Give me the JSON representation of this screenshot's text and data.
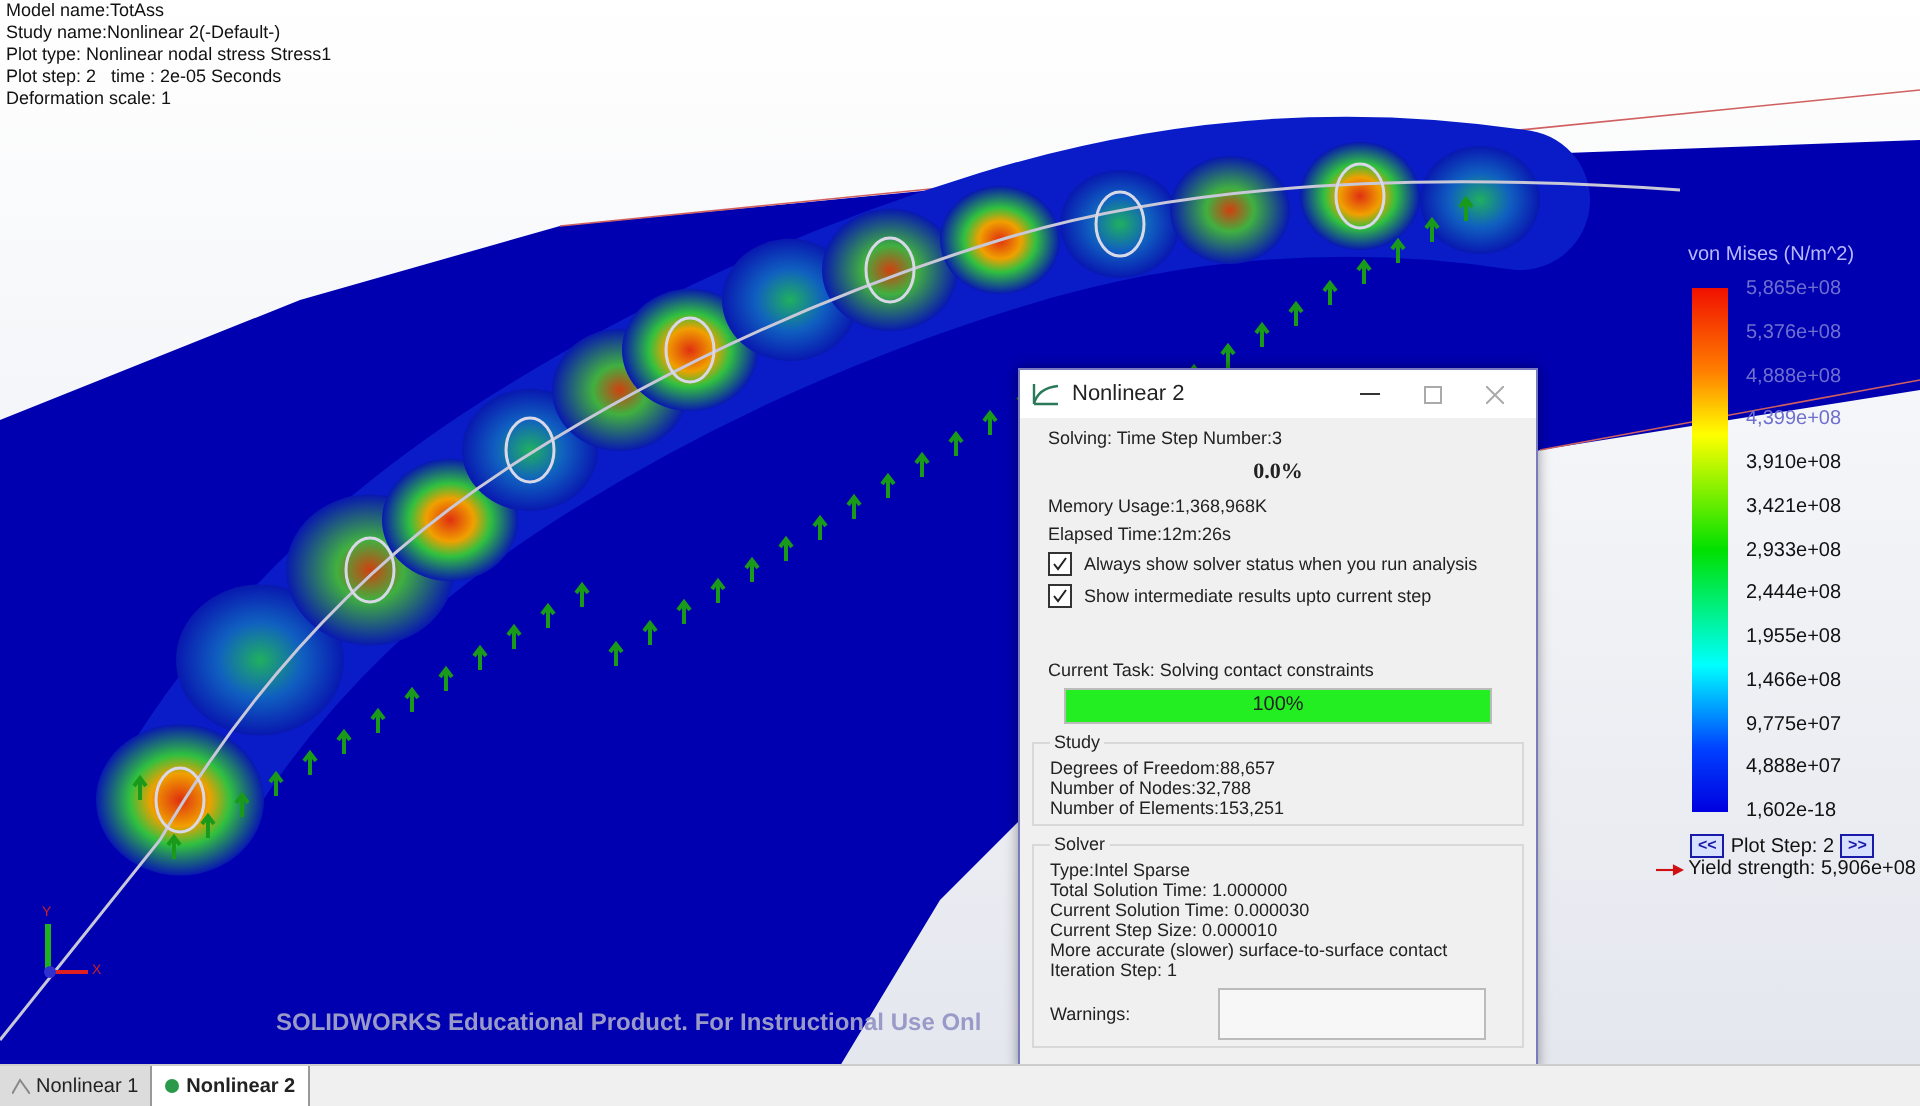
{
  "viewport": {
    "info_lines": [
      "Model name:TotAss",
      "Study name:Nonlinear 2(-Default-)",
      "Plot type: Nonlinear nodal stress Stress1",
      "Plot step: 2   time : 2e-05 Seconds",
      "Deformation scale: 1"
    ],
    "axis_labels": [
      "Y",
      "X"
    ],
    "product_notice": "SOLIDWORKS Educational Product. For Instructional Use Onl"
  },
  "legend": {
    "title": "von Mises (N/m^2)",
    "values": [
      "5,865e+08",
      "5,376e+08",
      "4,888e+08",
      "4,399e+08",
      "3,910e+08",
      "3,421e+08",
      "2,933e+08",
      "2,444e+08",
      "1,955e+08",
      "1,466e+08",
      "9,775e+07",
      "4,888e+07",
      "1,602e-18"
    ],
    "prev_button": "<<",
    "plot_step": "Plot Step: 2",
    "next_button": ">>",
    "yield_strength": "Yield strength: 5,906e+08"
  },
  "dialog": {
    "title": "Nonlinear 2",
    "status": "Solving:  Time Step Number:3",
    "percent": "0.0%",
    "memory": "Memory Usage:1,368,968K",
    "elapsed": "Elapsed Time:12m:26s",
    "options": [
      {
        "label": "Always show solver status when you run analysis",
        "checked": true
      },
      {
        "label": "Show intermediate results upto current step",
        "checked": true
      }
    ],
    "current_task": "Current Task: Solving contact constraints",
    "progress": {
      "level": 1,
      "text": "100%"
    },
    "study": {
      "title": "Study",
      "lines": [
        "Degrees of Freedom:88,657",
        "Number of Nodes:32,788",
        "Number of Elements:153,251"
      ]
    },
    "solver": {
      "title": "Solver",
      "lines": [
        "Type:Intel Sparse",
        "Total Solution Time:  1.000000",
        "Current Solution Time:  0.000030",
        "Current Step Size: 0.000010",
        "More accurate (slower) surface-to-surface contact",
        "Iteration Step: 1"
      ]
    },
    "warnings_label": "Warnings:"
  },
  "tabs": [
    {
      "label": "Nonlinear 1",
      "selected": false
    },
    {
      "label": "Nonlinear 2",
      "selected": true
    }
  ]
}
